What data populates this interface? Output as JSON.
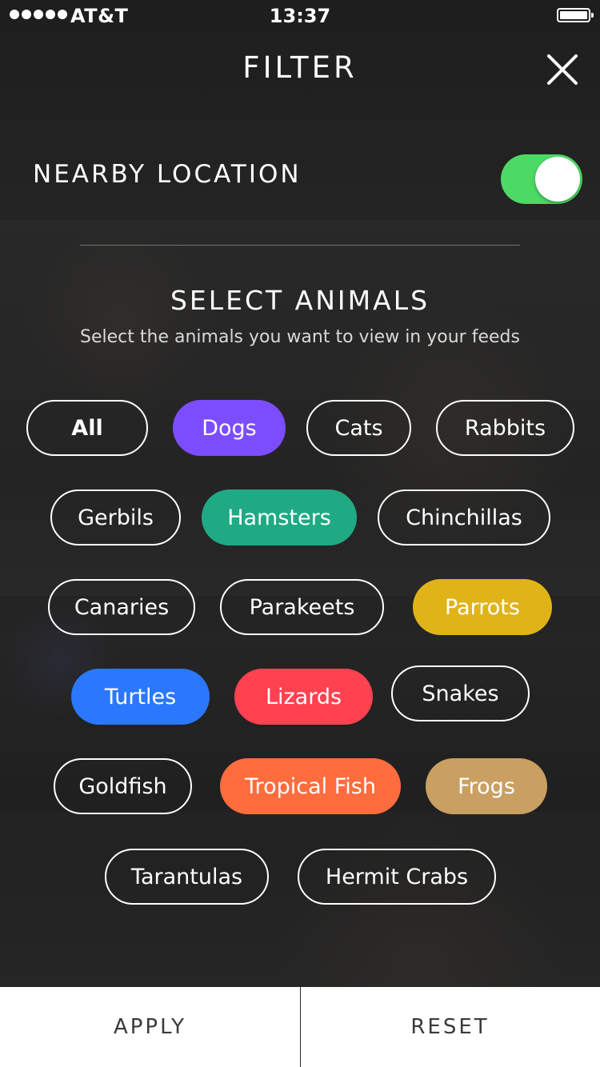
{
  "status_bar": {
    "carrier": "AT&T",
    "time": "13:37",
    "signal_bars": 5
  },
  "header": {
    "title": "FILTER",
    "close_icon": "close-icon"
  },
  "location": {
    "label": "NEARBY LOCATION",
    "toggle_on": true,
    "toggle_color": "#4cd964"
  },
  "animals": {
    "title": "SELECT ANIMALS",
    "subtitle": "Select the animals you want to view in your feeds",
    "chips": [
      {
        "label": "All",
        "selected": false,
        "color": null
      },
      {
        "label": "Dogs",
        "selected": true,
        "color": "#7c4dff"
      },
      {
        "label": "Cats",
        "selected": false,
        "color": null
      },
      {
        "label": "Rabbits",
        "selected": false,
        "color": null
      },
      {
        "label": "Gerbils",
        "selected": false,
        "color": null
      },
      {
        "label": "Hamsters",
        "selected": true,
        "color": "#1faa84"
      },
      {
        "label": "Chinchillas",
        "selected": false,
        "color": null
      },
      {
        "label": "Canaries",
        "selected": false,
        "color": null
      },
      {
        "label": "Parakeets",
        "selected": false,
        "color": null
      },
      {
        "label": "Parrots",
        "selected": true,
        "color": "#e0b418"
      },
      {
        "label": "Turtles",
        "selected": true,
        "color": "#2b78ff"
      },
      {
        "label": "Lizards",
        "selected": true,
        "color": "#ff4150"
      },
      {
        "label": "Snakes",
        "selected": false,
        "color": null
      },
      {
        "label": "Goldfish",
        "selected": false,
        "color": null
      },
      {
        "label": "Tropical Fish",
        "selected": true,
        "color": "#ff6c3d"
      },
      {
        "label": "Frogs",
        "selected": true,
        "color": "#c9a062"
      },
      {
        "label": "Tarantulas",
        "selected": false,
        "color": null
      },
      {
        "label": "Hermit Crabs",
        "selected": false,
        "color": null
      }
    ]
  },
  "footer": {
    "apply_label": "APPLY",
    "reset_label": "RESET"
  }
}
